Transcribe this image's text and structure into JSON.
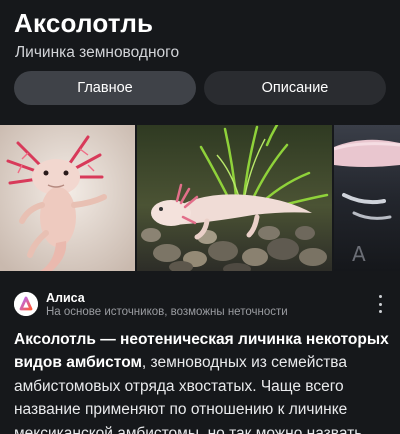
{
  "header": {
    "title": "Аксолотль",
    "subtitle": "Личинка земноводного"
  },
  "tabs": [
    {
      "label": "Главное",
      "active": true
    },
    {
      "label": "Описание",
      "active": false
    }
  ],
  "gallery": {
    "images": [
      {
        "subject": "pink axolotl with feathery gills on white background"
      },
      {
        "subject": "white axolotl on pebbles among green aquarium plants"
      },
      {
        "subject": "pale axolotl in dark water, partially visible"
      }
    ]
  },
  "source": {
    "logo_icon": "alice-icon",
    "name": "Алиса",
    "note": "На основе источников, возможны неточности"
  },
  "answer": {
    "lead_bold": "Аксолотль — неотеническая личинка некоторых видов амбистом",
    "rest": ", земноводных из семейства амбистомовых отряда хвостатых. Чаще всего название применяют по отношению к личинке мексиканской амбистомы, но так можно назвать"
  },
  "colors": {
    "background": "#16181b",
    "tab_active": "#3f4248",
    "tab_inactive": "#2a2c30",
    "alice_logo_gradient": [
      "#b26bff",
      "#ff5a3c"
    ]
  }
}
